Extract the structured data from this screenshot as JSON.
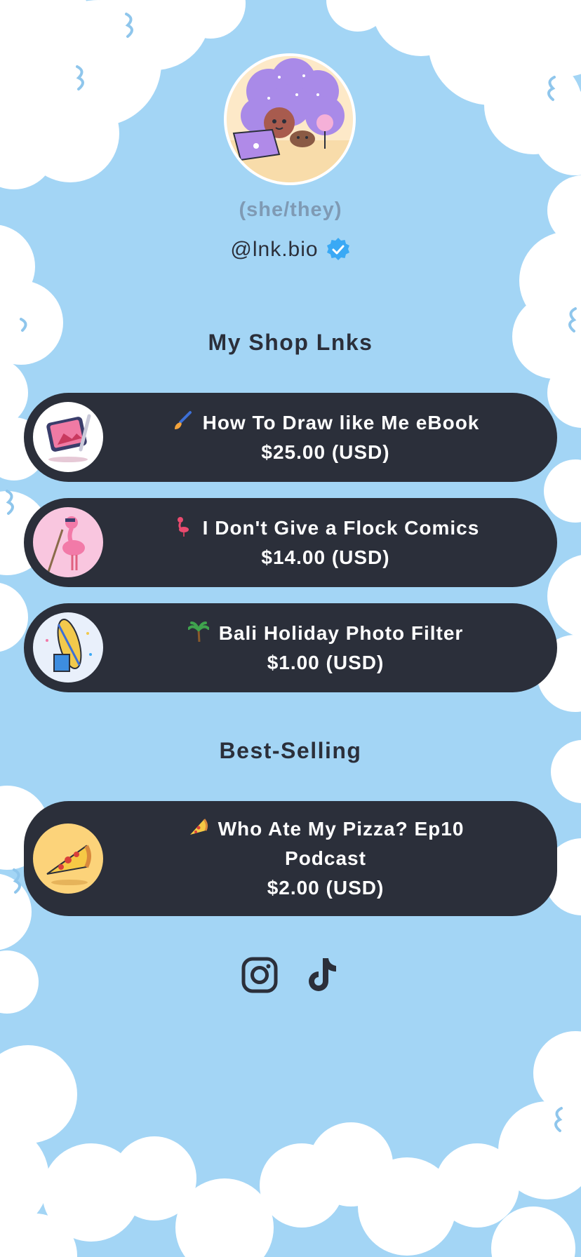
{
  "profile": {
    "pronouns": "(she/they)",
    "handle": "@lnk.bio",
    "verified_icon": "verified-badge-icon",
    "verified_color": "#3aa9f5"
  },
  "sections": {
    "shop_title": "My Shop Lnks",
    "best_title": "Best-Selling"
  },
  "links": [
    {
      "emoji_icon": "paintbrush-icon",
      "title": "How To Draw like Me eBook",
      "price": "$25.00 (USD)",
      "thumb_icon": "tablet-drawing-icon"
    },
    {
      "emoji_icon": "flamingo-icon",
      "title": "I Don't Give a Flock Comics",
      "price": "$14.00 (USD)",
      "thumb_icon": "flamingo-fishing-icon"
    },
    {
      "emoji_icon": "palm-tree-icon",
      "title": "Bali Holiday Photo Filter",
      "price": "$1.00 (USD)",
      "thumb_icon": "surfboard-icon"
    }
  ],
  "best_selling": [
    {
      "emoji_icon": "pizza-icon",
      "title_line1": "Who Ate My Pizza? Ep10",
      "title_line2": "Podcast",
      "price": "$2.00 (USD)",
      "thumb_icon": "pizza-slice-icon"
    }
  ],
  "socials": [
    {
      "icon": "instagram-icon"
    },
    {
      "icon": "tiktok-icon"
    }
  ],
  "colors": {
    "background": "#a3d5f5",
    "card": "#2b2f3a",
    "card_text": "#ffffff",
    "pronouns": "#7f9ab4"
  }
}
